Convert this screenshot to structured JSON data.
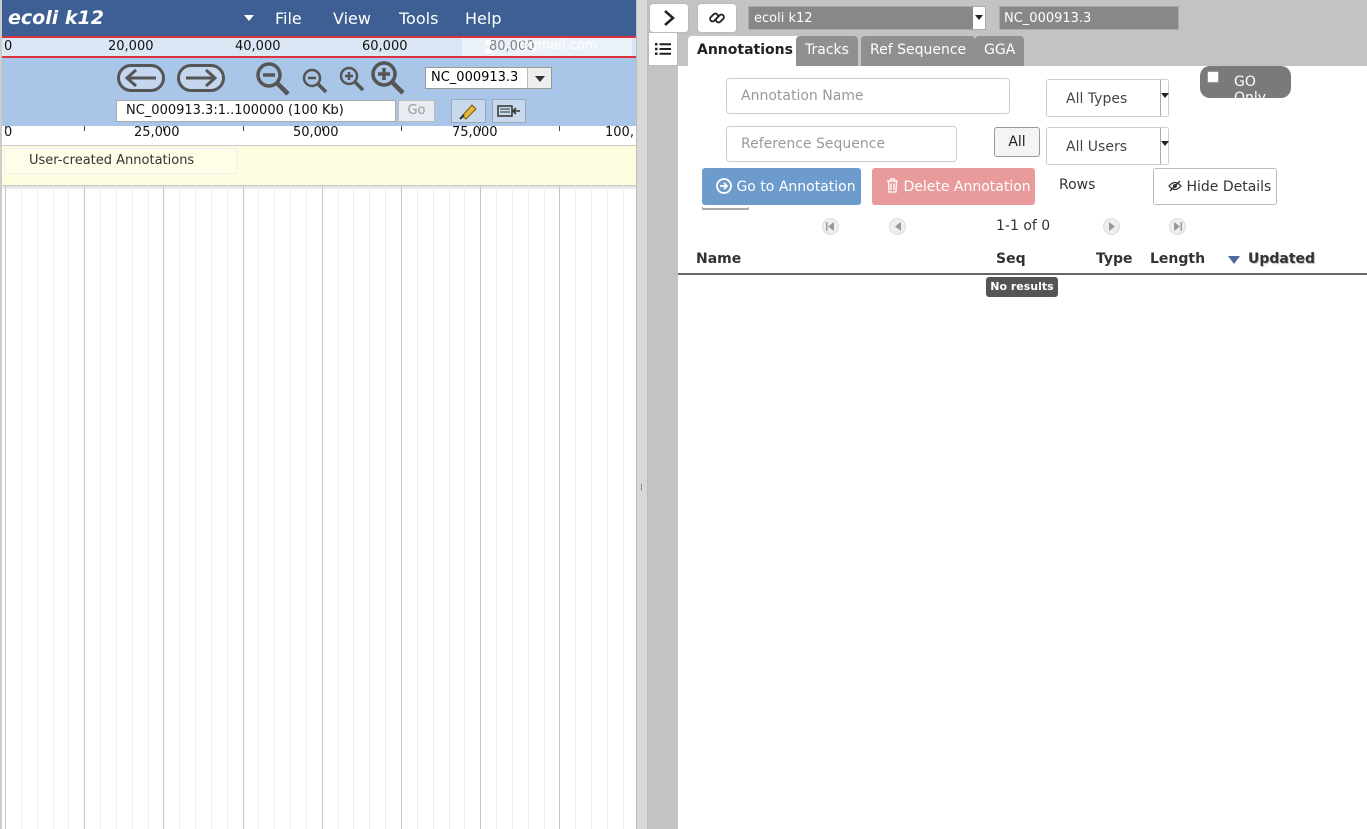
{
  "browser": {
    "organism_title": "ecoli k12",
    "menus": [
      "File",
      "View",
      "Tools",
      "Help"
    ],
    "overview_ticks": [
      "0",
      "20,000",
      "40,000",
      "60,000",
      "80,000"
    ],
    "user_email": "...@gmail.com",
    "ref_sequence": "NC_000913.3",
    "location": "NC_000913.3:1..100000 (100 Kb)",
    "go_label": "Go",
    "ruler_ticks": [
      "0",
      "25,000",
      "50,000",
      "75,000",
      "100,"
    ],
    "user_track_label": "User-created Annotations"
  },
  "annotator": {
    "organism": "ecoli k12",
    "sequence": "NC_000913.3",
    "tabs": [
      "Annotations",
      "Tracks",
      "Ref Sequence",
      "GGA"
    ],
    "active_tab": "Annotations",
    "filters": {
      "name_placeholder": "Annotation Name",
      "refseq_placeholder": "Reference Sequence",
      "type_value": "All Types",
      "user_value": "All Users",
      "all_label": "All",
      "go_only_label": "GO Only"
    },
    "buttons": {
      "goto": "Go to Annotation",
      "delete": "Delete Annotation",
      "rows": "Rows",
      "hide_details": "Hide Details"
    },
    "pager_text": "1-1 of 0",
    "columns": [
      "Name",
      "Seq",
      "Type",
      "Length",
      "Updated"
    ],
    "empty_message": "No results"
  },
  "colors": {
    "menubar": "#3e5f93",
    "navbar": "#a9c6e8",
    "overview_border": "#d9333f",
    "goto_button": "#6d9ccc",
    "delete_button": "#e99b9b"
  }
}
